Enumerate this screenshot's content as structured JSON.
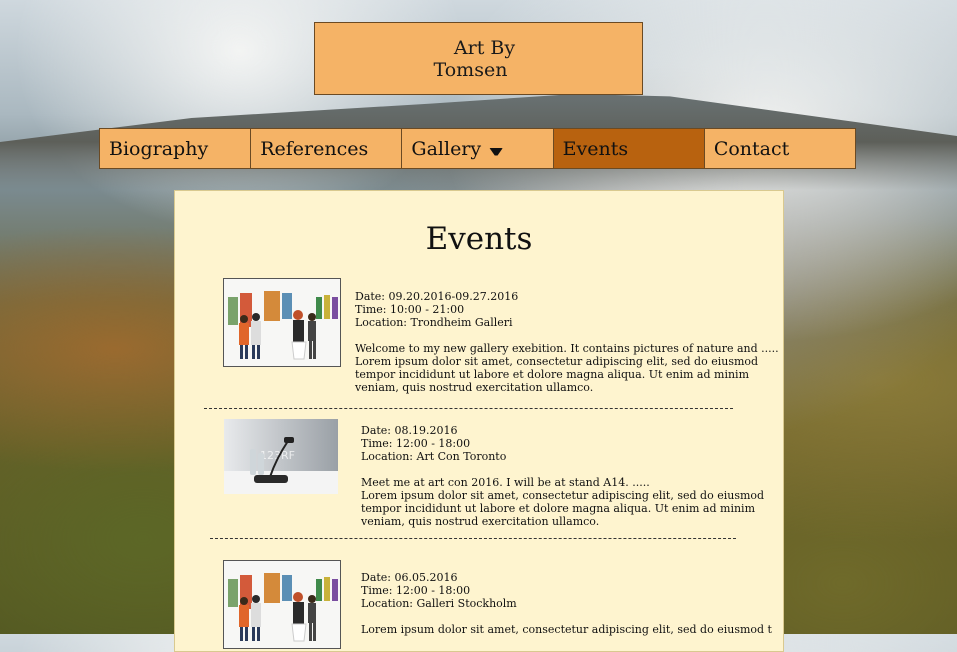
{
  "header": {
    "line1": "Art By",
    "line2": "Tomsen"
  },
  "nav": [
    {
      "label": "Biography"
    },
    {
      "label": "References"
    },
    {
      "label": "Gallery",
      "has_dropdown": true
    },
    {
      "label": "Events",
      "active": true
    },
    {
      "label": "Contact"
    }
  ],
  "page_title": "Events",
  "events": [
    {
      "date": "Date: 09.20.2016-09.27.2016",
      "time": "Time: 10:00 - 21:00",
      "location": "Location: Trondheim Galleri",
      "body": [
        "Welcome to my new gallery exebition. It contains pictures of nature and .....",
        "Lorem ipsum dolor sit amet, consectetur adipiscing elit, sed do eiusmod",
        "tempor incididunt ut labore et dolore magna aliqua. Ut enim ad minim",
        "veniam, quis nostrud exercitation ullamco."
      ],
      "image": "gallery-visitors"
    },
    {
      "date": "Date: 08.19.2016",
      "time": "Time: 12:00 - 18:00",
      "location": "Location: Art Con Toronto",
      "body": [
        "Meet me at art con 2016. I will be at stand A14. .....",
        "Lorem ipsum dolor sit amet, consectetur adipiscing elit, sed do eiusmod",
        "tempor incididunt ut labore et dolore magna aliqua. Ut enim ad minim",
        "veniam, quis nostrud exercitation ullamco."
      ],
      "image": "conference-microphone",
      "watermark": "123RF"
    },
    {
      "date": "Date: 06.05.2016",
      "time": "Time: 12:00 - 18:00",
      "location": "Location: Galleri Stockholm",
      "body": [
        "Lorem ipsum dolor sit amet, consectetur adipiscing elit, sed do eiusmod t"
      ],
      "image": "gallery-visitors"
    }
  ],
  "colors": {
    "nav_bg": "#f5b366",
    "nav_active": "#b8620f",
    "content_bg": "#fef4cf"
  }
}
